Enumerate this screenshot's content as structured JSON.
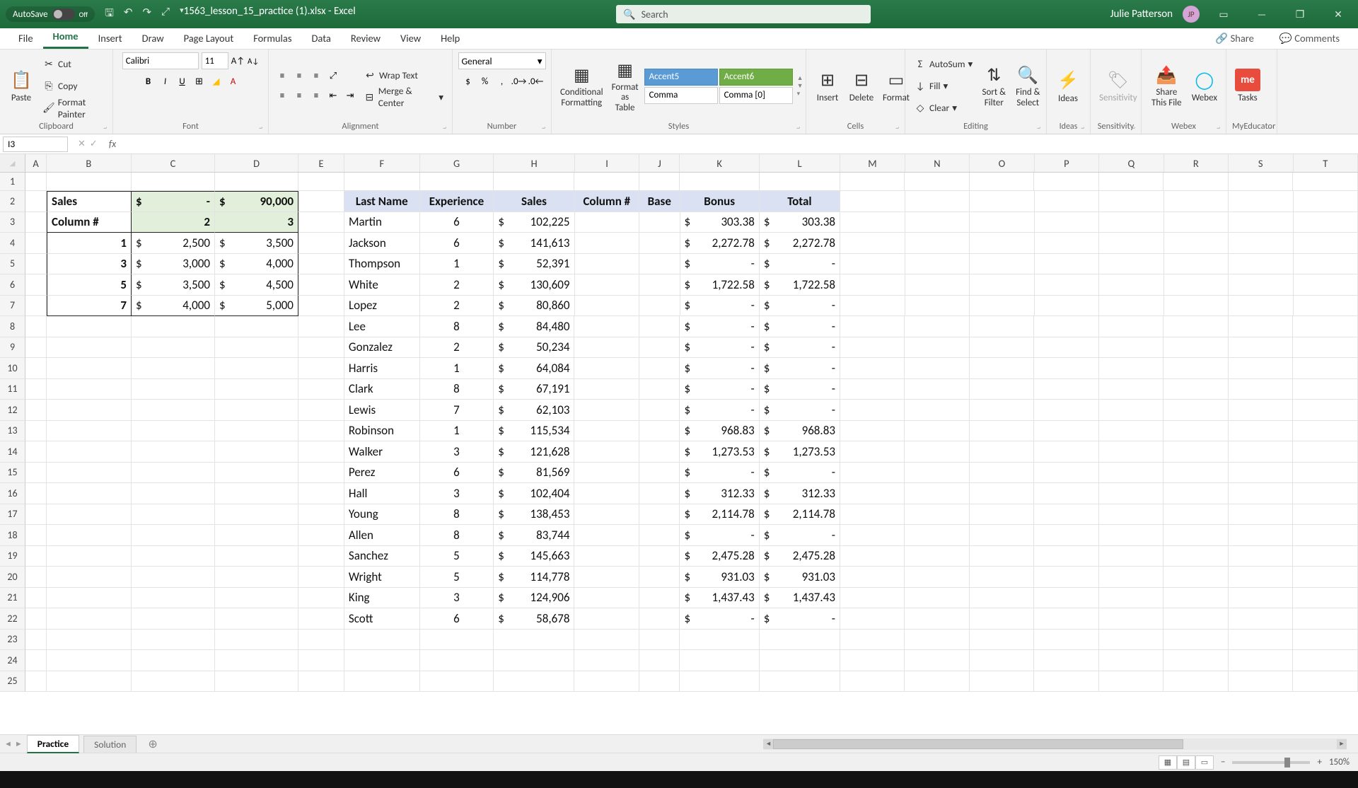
{
  "titlebar": {
    "autosave_label": "AutoSave",
    "autosave_state": "Off",
    "filename": "1563_lesson_15_practice (1).xlsx - Excel",
    "search_placeholder": "Search",
    "username": "Julie Patterson",
    "user_initials": "JP"
  },
  "tabs": {
    "items": [
      "File",
      "Home",
      "Insert",
      "Draw",
      "Page Layout",
      "Formulas",
      "Data",
      "Review",
      "View",
      "Help"
    ],
    "active": "Home",
    "share": "Share",
    "comments": "Comments"
  },
  "ribbon": {
    "clipboard": {
      "label": "Clipboard",
      "cut": "Cut",
      "copy": "Copy",
      "paste": "Paste",
      "painter": "Format Painter"
    },
    "font": {
      "label": "Font",
      "name": "Calibri",
      "size": "11"
    },
    "alignment": {
      "label": "Alignment",
      "wrap": "Wrap Text",
      "merge": "Merge & Center"
    },
    "number": {
      "label": "Number",
      "format": "General"
    },
    "styles": {
      "label": "Styles",
      "conditional": "Conditional Formatting",
      "table": "Format as Table",
      "accent5": "Accent5",
      "accent6": "Accent6",
      "comma": "Comma",
      "comma0": "Comma [0]"
    },
    "cells": {
      "label": "Cells",
      "insert": "Insert",
      "delete": "Delete",
      "format": "Format"
    },
    "editing": {
      "label": "Editing",
      "autosum": "AutoSum",
      "fill": "Fill",
      "clear": "Clear",
      "sort": "Sort & Filter",
      "find": "Find & Select"
    },
    "ideas": {
      "label": "Ideas",
      "btn": "Ideas"
    },
    "sensitivity": {
      "label": "Sensitivity",
      "btn": "Sensitivity"
    },
    "webex": {
      "label": "Webex",
      "share": "Share This File",
      "webex": "Webex"
    },
    "myeducator": {
      "label": "MyEducator",
      "tasks": "Tasks"
    }
  },
  "namebox": "I3",
  "columns": [
    "A",
    "B",
    "C",
    "D",
    "E",
    "F",
    "G",
    "H",
    "I",
    "J",
    "K",
    "L",
    "M",
    "N",
    "O",
    "P",
    "Q",
    "R",
    "S",
    "T"
  ],
  "column_widths": [
    "cA",
    "cB",
    "cC",
    "cD",
    "cE",
    "cF",
    "cG",
    "cH",
    "cI",
    "cJ",
    "cK",
    "cL",
    "cM",
    "cN",
    "cO",
    "cP",
    "cQ",
    "cR",
    "cS",
    "cT"
  ],
  "left_table": {
    "r2": {
      "B": "Sales",
      "C": {
        "cur": "$",
        "val": "-"
      },
      "D": {
        "cur": "$",
        "val": "90,000"
      }
    },
    "r3": {
      "B": "Column #",
      "C": "2",
      "D": "3"
    },
    "rows": [
      {
        "B": "1",
        "C": {
          "cur": "$",
          "val": "2,500"
        },
        "D": {
          "cur": "$",
          "val": "3,500"
        }
      },
      {
        "B": "3",
        "C": {
          "cur": "$",
          "val": "3,000"
        },
        "D": {
          "cur": "$",
          "val": "4,000"
        }
      },
      {
        "B": "5",
        "C": {
          "cur": "$",
          "val": "3,500"
        },
        "D": {
          "cur": "$",
          "val": "4,500"
        }
      },
      {
        "B": "7",
        "C": {
          "cur": "$",
          "val": "4,000"
        },
        "D": {
          "cur": "$",
          "val": "5,000"
        }
      }
    ]
  },
  "main_headers": {
    "F": "Last Name",
    "G": "Experience",
    "H": "Sales",
    "I": "Column #",
    "J": "Base",
    "K": "Bonus",
    "L": "Total"
  },
  "main_rows": [
    {
      "F": "Martin",
      "G": "6",
      "H": {
        "cur": "$",
        "val": "102,225"
      },
      "K": {
        "cur": "$",
        "val": "303.38"
      },
      "L": {
        "cur": "$",
        "val": "303.38"
      }
    },
    {
      "F": "Jackson",
      "G": "6",
      "H": {
        "cur": "$",
        "val": "141,613"
      },
      "K": {
        "cur": "$",
        "val": "2,272.78"
      },
      "L": {
        "cur": "$",
        "val": "2,272.78"
      }
    },
    {
      "F": "Thompson",
      "G": "1",
      "H": {
        "cur": "$",
        "val": "52,391"
      },
      "K": {
        "cur": "$",
        "val": "-"
      },
      "L": {
        "cur": "$",
        "val": "-"
      }
    },
    {
      "F": "White",
      "G": "2",
      "H": {
        "cur": "$",
        "val": "130,609"
      },
      "K": {
        "cur": "$",
        "val": "1,722.58"
      },
      "L": {
        "cur": "$",
        "val": "1,722.58"
      }
    },
    {
      "F": "Lopez",
      "G": "2",
      "H": {
        "cur": "$",
        "val": "80,860"
      },
      "K": {
        "cur": "$",
        "val": "-"
      },
      "L": {
        "cur": "$",
        "val": "-"
      }
    },
    {
      "F": "Lee",
      "G": "8",
      "H": {
        "cur": "$",
        "val": "84,480"
      },
      "K": {
        "cur": "$",
        "val": "-"
      },
      "L": {
        "cur": "$",
        "val": "-"
      }
    },
    {
      "F": "Gonzalez",
      "G": "2",
      "H": {
        "cur": "$",
        "val": "50,234"
      },
      "K": {
        "cur": "$",
        "val": "-"
      },
      "L": {
        "cur": "$",
        "val": "-"
      }
    },
    {
      "F": "Harris",
      "G": "1",
      "H": {
        "cur": "$",
        "val": "64,084"
      },
      "K": {
        "cur": "$",
        "val": "-"
      },
      "L": {
        "cur": "$",
        "val": "-"
      }
    },
    {
      "F": "Clark",
      "G": "8",
      "H": {
        "cur": "$",
        "val": "67,191"
      },
      "K": {
        "cur": "$",
        "val": "-"
      },
      "L": {
        "cur": "$",
        "val": "-"
      }
    },
    {
      "F": "Lewis",
      "G": "7",
      "H": {
        "cur": "$",
        "val": "62,103"
      },
      "K": {
        "cur": "$",
        "val": "-"
      },
      "L": {
        "cur": "$",
        "val": "-"
      }
    },
    {
      "F": "Robinson",
      "G": "1",
      "H": {
        "cur": "$",
        "val": "115,534"
      },
      "K": {
        "cur": "$",
        "val": "968.83"
      },
      "L": {
        "cur": "$",
        "val": "968.83"
      }
    },
    {
      "F": "Walker",
      "G": "3",
      "H": {
        "cur": "$",
        "val": "121,628"
      },
      "K": {
        "cur": "$",
        "val": "1,273.53"
      },
      "L": {
        "cur": "$",
        "val": "1,273.53"
      }
    },
    {
      "F": "Perez",
      "G": "6",
      "H": {
        "cur": "$",
        "val": "81,569"
      },
      "K": {
        "cur": "$",
        "val": "-"
      },
      "L": {
        "cur": "$",
        "val": "-"
      }
    },
    {
      "F": "Hall",
      "G": "3",
      "H": {
        "cur": "$",
        "val": "102,404"
      },
      "K": {
        "cur": "$",
        "val": "312.33"
      },
      "L": {
        "cur": "$",
        "val": "312.33"
      }
    },
    {
      "F": "Young",
      "G": "8",
      "H": {
        "cur": "$",
        "val": "138,453"
      },
      "K": {
        "cur": "$",
        "val": "2,114.78"
      },
      "L": {
        "cur": "$",
        "val": "2,114.78"
      }
    },
    {
      "F": "Allen",
      "G": "8",
      "H": {
        "cur": "$",
        "val": "83,744"
      },
      "K": {
        "cur": "$",
        "val": "-"
      },
      "L": {
        "cur": "$",
        "val": "-"
      }
    },
    {
      "F": "Sanchez",
      "G": "5",
      "H": {
        "cur": "$",
        "val": "145,663"
      },
      "K": {
        "cur": "$",
        "val": "2,475.28"
      },
      "L": {
        "cur": "$",
        "val": "2,475.28"
      }
    },
    {
      "F": "Wright",
      "G": "5",
      "H": {
        "cur": "$",
        "val": "114,778"
      },
      "K": {
        "cur": "$",
        "val": "931.03"
      },
      "L": {
        "cur": "$",
        "val": "931.03"
      }
    },
    {
      "F": "King",
      "G": "3",
      "H": {
        "cur": "$",
        "val": "124,906"
      },
      "K": {
        "cur": "$",
        "val": "1,437.43"
      },
      "L": {
        "cur": "$",
        "val": "1,437.43"
      }
    },
    {
      "F": "Scott",
      "G": "6",
      "H": {
        "cur": "$",
        "val": "58,678"
      },
      "K": {
        "cur": "$",
        "val": "-"
      },
      "L": {
        "cur": "$",
        "val": "-"
      }
    }
  ],
  "sheets": {
    "active": "Practice",
    "other": "Solution"
  },
  "statusbar": {
    "zoom": "150%"
  }
}
